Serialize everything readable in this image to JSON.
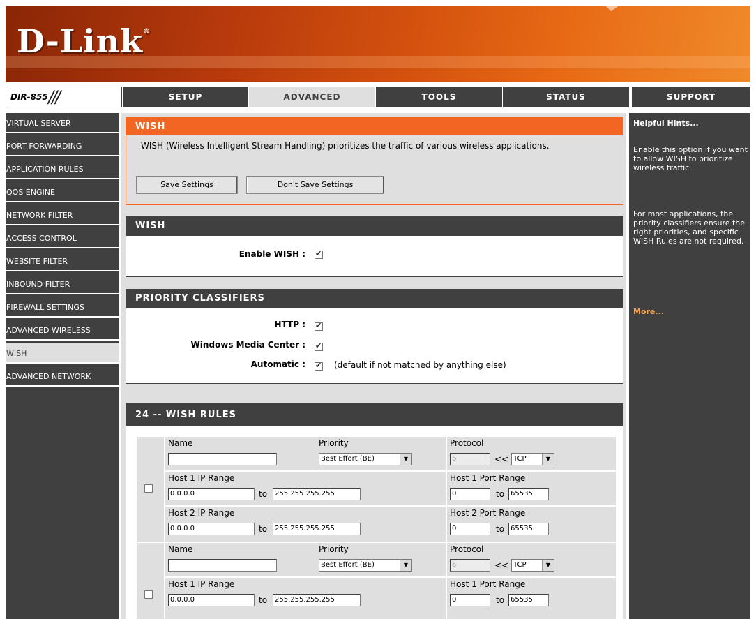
{
  "brand": {
    "logo_text": "D-Link",
    "registered": "®",
    "model": "DIR-855",
    "model_mark": "///"
  },
  "tabs": [
    {
      "label": "SETUP"
    },
    {
      "label": "ADVANCED"
    },
    {
      "label": "TOOLS"
    },
    {
      "label": "STATUS"
    },
    {
      "label": "SUPPORT"
    }
  ],
  "active_tab": "ADVANCED",
  "sidebar": {
    "items": [
      {
        "label": "VIRTUAL SERVER"
      },
      {
        "label": "PORT FORWARDING"
      },
      {
        "label": "APPLICATION RULES"
      },
      {
        "label": "QOS ENGINE"
      },
      {
        "label": "NETWORK FILTER"
      },
      {
        "label": "ACCESS CONTROL"
      },
      {
        "label": "WEBSITE FILTER"
      },
      {
        "label": "INBOUND FILTER"
      },
      {
        "label": "FIREWALL SETTINGS"
      },
      {
        "label": "ADVANCED WIRELESS"
      },
      {
        "label": "WISH"
      },
      {
        "label": "ADVANCED NETWORK"
      }
    ],
    "active": "WISH"
  },
  "wish_intro": {
    "title": "WISH",
    "description": "WISH (Wireless Intelligent Stream Handling) prioritizes the traffic of various wireless applications.",
    "save_label": "Save Settings",
    "dont_save_label": "Don't Save Settings"
  },
  "wish_section": {
    "title": "WISH",
    "enable_label": "Enable WISH :",
    "enable_checked": true
  },
  "priority_classifiers": {
    "title": "PRIORITY CLASSIFIERS",
    "http_label": "HTTP :",
    "http_checked": true,
    "wmc_label": "Windows Media Center :",
    "wmc_checked": true,
    "auto_label": "Automatic :",
    "auto_checked": true,
    "auto_note": "(default if not matched by anything else)"
  },
  "wish_rules": {
    "title": "24 -- WISH RULES",
    "labels": {
      "name": "Name",
      "priority": "Priority",
      "protocol": "Protocol",
      "host1_ip": "Host 1 IP Range",
      "host1_port": "Host 1 Port Range",
      "host2_ip": "Host 2 IP Range",
      "host2_port": "Host 2 Port Range",
      "to": "to",
      "arrow": "<<"
    },
    "rules": [
      {
        "enabled": false,
        "name": "",
        "priority": "Best Effort (BE)",
        "protocol_num": "6",
        "protocol": "TCP",
        "h1_ip_start": "0.0.0.0",
        "h1_ip_end": "255.255.255.255",
        "h1_port_start": "0",
        "h1_port_end": "65535",
        "h2_ip_start": "0.0.0.0",
        "h2_ip_end": "255.255.255.255",
        "h2_port_start": "0",
        "h2_port_end": "65535"
      },
      {
        "enabled": false,
        "name": "",
        "priority": "Best Effort (BE)",
        "protocol_num": "6",
        "protocol": "TCP",
        "h1_ip_start": "0.0.0.0",
        "h1_ip_end": "255.255.255.255",
        "h1_port_start": "0",
        "h1_port_end": "65535"
      }
    ]
  },
  "hints": {
    "title": "Helpful Hints...",
    "p1": "Enable this option if you want to allow WISH to prioritize wireless traffic.",
    "p2": "For most applications, the priority classifiers ensure the right priorities, and specific WISH Rules are not required.",
    "more": "More..."
  }
}
